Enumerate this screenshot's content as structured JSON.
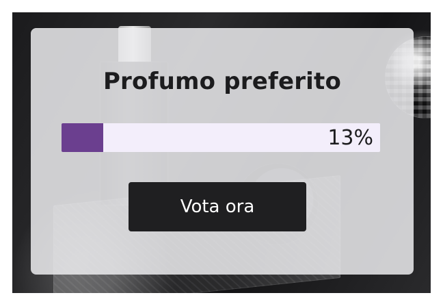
{
  "poll": {
    "title": "Profumo preferito",
    "progress": {
      "value": 0.13,
      "label": "13%"
    },
    "cta_label": "Vota ora"
  },
  "colors": {
    "accent": "#6b3f8f",
    "button_bg": "#1f1f21",
    "text": "#1c1c1e"
  }
}
